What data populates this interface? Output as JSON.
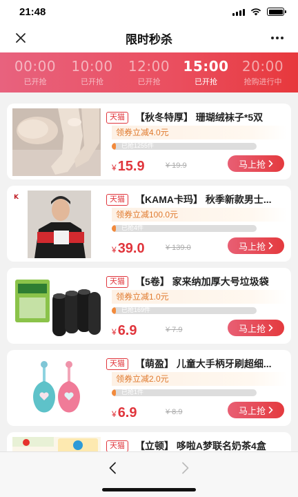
{
  "status_bar": {
    "time": "21:48"
  },
  "nav": {
    "title": "限时秒杀",
    "close_icon": "close-icon",
    "more_icon": "more-icon"
  },
  "time_slots": [
    {
      "time": "00:00",
      "status": "已开抢",
      "active": false
    },
    {
      "time": "10:00",
      "status": "已开抢",
      "active": false
    },
    {
      "time": "12:00",
      "status": "已开抢",
      "active": false
    },
    {
      "time": "15:00",
      "status": "已开抢",
      "active": true
    },
    {
      "time": "20:00",
      "status": "抢购进行中",
      "active": false
    }
  ],
  "products": [
    {
      "tag": "天猫",
      "title": "【秋冬特厚】 珊瑚绒袜子*5双",
      "coupon": "领券立减4.0元",
      "sold": "已抢1255件",
      "progress": 0.03,
      "price_symbol": "¥",
      "price": "15.9",
      "original_price": "¥ 19.9",
      "buy_label": "马上抢"
    },
    {
      "tag": "天猫",
      "title": "【KAMA卡玛】 秋季新款男士...",
      "coupon": "领券立减100.0元",
      "sold": "已抢4件",
      "progress": 0.03,
      "price_symbol": "¥",
      "price": "39.0",
      "original_price": "¥ 139.0",
      "buy_label": "马上抢"
    },
    {
      "tag": "天猫",
      "title": "【5卷】 家来纳加厚大号垃圾袋",
      "coupon": "领券立减1.0元",
      "sold": "已抢169件",
      "progress": 0.03,
      "price_symbol": "¥",
      "price": "6.9",
      "original_price": "¥ 7.9",
      "buy_label": "马上抢"
    },
    {
      "tag": "天猫",
      "title": "【萌盈】 儿童大手柄牙刷超细...",
      "coupon": "领券立减2.0元",
      "sold": "已抢1件",
      "progress": 0.03,
      "price_symbol": "¥",
      "price": "6.9",
      "original_price": "¥ 8.9",
      "buy_label": "马上抢"
    },
    {
      "tag": "天猫",
      "title": "【立顿】 哆啦A梦联名奶茶4盒"
    }
  ],
  "colors": {
    "accent": "#e0353c",
    "coupon_text": "#e07a2e",
    "progress_fill": "#f28a3c"
  }
}
